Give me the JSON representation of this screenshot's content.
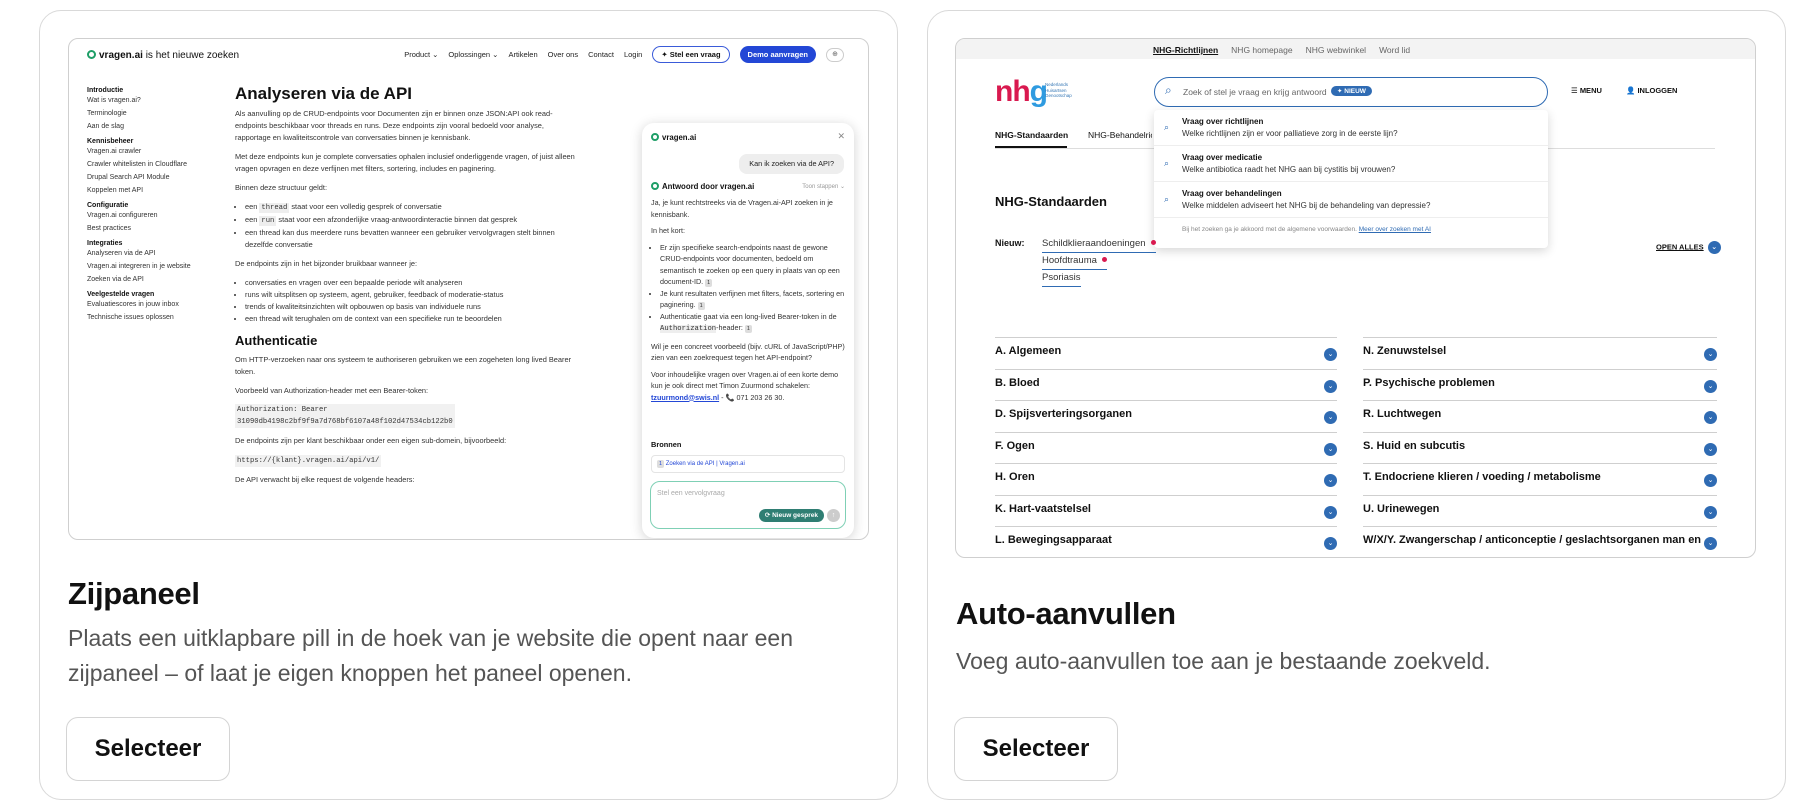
{
  "cards": [
    {
      "title": "Zijpaneel",
      "description": "Plaats een uitklapbare pill in de hoek van je website die opent naar een zijpaneel – of laat je eigen knoppen het paneel openen.",
      "button": "Selecteer",
      "preview": {
        "logo_brand": "vragen.ai",
        "logo_tag": "is het nieuwe zoeken",
        "nav": [
          "Product ⌄",
          "Oplossingen ⌄",
          "Artikelen",
          "Over ons",
          "Contact",
          "Login"
        ],
        "ask_pill": "Stel een vraag",
        "demo_btn": "Demo aanvragen",
        "sidebar": [
          {
            "group": "Introductie",
            "items": [
              "Wat is vragen.ai?",
              "Terminologie",
              "Aan de slag"
            ]
          },
          {
            "group": "Kennisbeheer",
            "items": [
              "Vragen.ai crawler",
              "Crawler whitelisten in Cloudflare",
              "Drupal Search API Module",
              "Koppelen met API"
            ]
          },
          {
            "group": "Configuratie",
            "items": [
              "Vragen.ai configureren",
              "Best practices"
            ]
          },
          {
            "group": "Integraties",
            "items": [
              "Analyseren via de API",
              "Vragen.ai integreren in je website",
              "Zoeken via de API"
            ]
          },
          {
            "group": "Veelgestelde vragen",
            "items": [
              "Evaluatiescores in jouw inbox",
              "Technische issues oplossen"
            ]
          }
        ],
        "main": {
          "h1": "Analyseren via de API",
          "p1": "Als aanvulling op de CRUD-endpoints voor Documenten zijn er binnen onze JSON:API ook read-endpoints beschikbaar voor threads en runs. Deze endpoints zijn vooral bedoeld voor analyse, rapportage en kwaliteitscontrole van conversaties binnen je kennisbank.",
          "p2": "Met deze endpoints kun je complete conversaties ophalen inclusief onderliggende vragen, of juist alleen vragen opvragen en deze verfijnen met filters, sortering, includes en paginering.",
          "p3": "Binnen deze structuur geldt:",
          "li1_a": "een ",
          "li1_code": "thread",
          "li1_b": " staat voor een volledig gesprek of conversatie",
          "li2_a": "een ",
          "li2_code": "run",
          "li2_b": " staat voor een afzonderlijke vraag-antwoordinteractie binnen dat gesprek",
          "li3": "een thread kan dus meerdere runs bevatten wanneer een gebruiker vervolgvragen stelt binnen dezelfde conversatie",
          "p4": "De endpoints zijn in het bijzonder bruikbaar wanneer je:",
          "li4": "conversaties en vragen over een bepaalde periode wilt analyseren",
          "li5": "runs wilt uitsplitsen op systeem, agent, gebruiker, feedback of moderatie-status",
          "li6": "trends of kwaliteitsinzichten wilt opbouwen op basis van individuele runs",
          "li7": "een thread wilt terughalen om de context van een specifieke run te beoordelen",
          "h2": "Authenticatie",
          "p5": "Om HTTP-verzoeken naar ons systeem te authoriseren gebruiken we een zogeheten long lived Bearer token.",
          "p6": "Voorbeeld van Authorization-header met een Bearer-token:",
          "code1": "Authorization: Bearer",
          "code2": "31090db4198c2bf9f9a7d768bf6107a48f102d47534cb122b0",
          "p7": "De endpoints zijn per klant beschikbaar onder een eigen sub-domein, bijvoorbeeld:",
          "code3": "https://{klant}.vragen.ai/api/v1/",
          "p8": "De API verwacht bij elke request de volgende headers:"
        },
        "chat": {
          "title": "vragen.ai",
          "question": "Kan ik zoeken via de API?",
          "answer_title": "Antwoord door vragen.ai",
          "toggle": "Toon stappen",
          "a1": "Ja, je kunt rechtstreeks via de Vragen.ai-API zoeken in je kennisbank.",
          "a2": "In het kort:",
          "b1": "Er zijn specifieke search-endpoints naast de gewone CRUD-endpoints voor documenten, bedoeld om semantisch te zoeken op een query in plaats van op een document-ID.",
          "b2": "Je kunt resultaten verfijnen met filters, facets, sortering en paginering.",
          "b3_a": "Authenticatie gaat via een long-lived Bearer-token in de ",
          "b3_code": "Authorization",
          "b3_b": "-header:",
          "cite": "1",
          "a3": "Wil je een concreet voorbeeld (bijv. cURL of JavaScript/PHP) zien van een zoekrequest tegen het API-endpoint?",
          "a4": "Voor inhoudelijke vragen over Vragen.ai of een korte demo kun je ook direct met Timon Zuurmond schakelen:",
          "email": "tzuurmond@swis.nl",
          "phone": " - 📞 071 203 26 30.",
          "sources_title": "Bronnen",
          "source": "Zoeken via de API | Vragen.ai",
          "input_placeholder": "Stel een vervolgvraag",
          "new_chat": "Nieuw gesprek"
        }
      }
    },
    {
      "title": "Auto-aanvullen",
      "description": "Voeg auto-aanvullen toe aan je bestaande zoekveld.",
      "button": "Selecteer",
      "preview": {
        "top_links": [
          "NHG-Richtlijnen",
          "NHG homepage",
          "NHG webwinkel",
          "Word lid"
        ],
        "logo": "nhg",
        "logo_sub": "Nederlands Huisartsen Genootschap",
        "search_placeholder": "Zoek of stel je vraag en krijg antwoord",
        "nieuw_badge": "NIEUW",
        "menu": "MENU",
        "login": "INLOGGEN",
        "suggestions": [
          {
            "title": "Vraag over richtlijnen",
            "text": "Welke richtlijnen zijn er voor palliatieve zorg in de eerste lijn?"
          },
          {
            "title": "Vraag over medicatie",
            "text": "Welke antibiotica raadt het NHG aan bij cystitis bij vrouwen?"
          },
          {
            "title": "Vraag over behandelingen",
            "text": "Welke middelen adviseert het NHG bij de behandeling van depressie?"
          }
        ],
        "dropdown_footer": "Bij het zoeken ga je akkoord met de algemene voorwaarden.",
        "dropdown_footer_link": "Meer over zoeken met AI",
        "tabs": [
          "NHG-Standaarden",
          "NHG-Behandelrichtlijnen"
        ],
        "heading": "NHG-Standaarden",
        "new_label": "Nieuw:",
        "new_items": [
          "Schildklieraandoeningen",
          "Hoofdtrauma",
          "Psoriasis"
        ],
        "open_all": "OPEN ALLES",
        "left_list": [
          "A. Algemeen",
          "B. Bloed",
          "D. Spijsverteringsorganen",
          "F. Ogen",
          "H. Oren",
          "K. Hart-vaatstelsel",
          "L. Bewegingsapparaat"
        ],
        "right_list": [
          "N. Zenuwstelsel",
          "P. Psychische problemen",
          "R. Luchtwegen",
          "S. Huid en subcutis",
          "T. Endocriene klieren / voeding / metabolisme",
          "U. Urinewegen",
          "W/X/Y. Zwangerschap / anticonceptie / geslachtsorganen man en"
        ]
      }
    }
  ]
}
